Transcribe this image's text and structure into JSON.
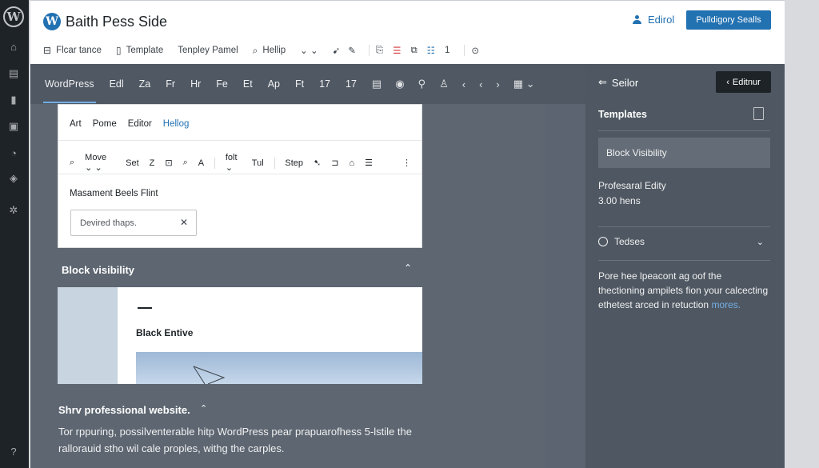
{
  "admin_menu": {
    "logo": "W",
    "icons": [
      "home-icon",
      "posts-icon",
      "lock-icon",
      "pages-icon",
      "appearance-icon",
      "plugins-icon",
      "settings-icon"
    ]
  },
  "header": {
    "site_logo": "W",
    "site_title": "Baith Pess Side",
    "user_label": "Edirol",
    "publish_label": "Pulldigory Sealls",
    "toolbar": [
      {
        "label": "Flcar tance",
        "icon": "layout-icon"
      },
      {
        "label": "Template",
        "icon": "file-icon"
      },
      {
        "label": "Tenpley Pamel",
        "icon": ""
      },
      {
        "label": "Hellip",
        "icon": "search-icon"
      }
    ]
  },
  "block_tabs": {
    "labels": [
      "WordPress",
      "Edl",
      "Za",
      "Fr",
      "Hr",
      "Fe",
      "Et",
      "Ap",
      "Ft",
      "17",
      "17"
    ]
  },
  "inner": {
    "nav": [
      "Art",
      "Pome",
      "Editor"
    ],
    "nav_link": "Hellog",
    "format_items": [
      "Move",
      "Set",
      "Z",
      "Step",
      "folt",
      "Tul"
    ],
    "heading": "Masament Beels Flint",
    "input_placeholder": "Devired thaps."
  },
  "block_visibility": {
    "title": "Block visibility",
    "preview_title": "Black Entive"
  },
  "promo": {
    "title": "Shrv professional website.",
    "text": "Tor rppuring, possilventerable hitp WordPress pear prapuarofhess 5-lstile the rallorauid stho wil cale proples, withg the carples."
  },
  "settings": {
    "back_label": "Seilor",
    "editor_button": "Editnur",
    "section_title": "Templates",
    "selected_item": "Block Visibility",
    "meta_label": "Profesaral Edity",
    "meta_value": "3.00 hens",
    "collapsible_label": "Tedses",
    "description": "Pore hee lpeacont ag oof the thectioning ampilets fion your calcecting ethetest arced in retuction",
    "more_link": "mores."
  },
  "colors": {
    "accent": "#2271b1",
    "admin_bar": "#1d2327",
    "editor_bg": "#5b6470",
    "sidebar_bg": "#4f5862"
  }
}
